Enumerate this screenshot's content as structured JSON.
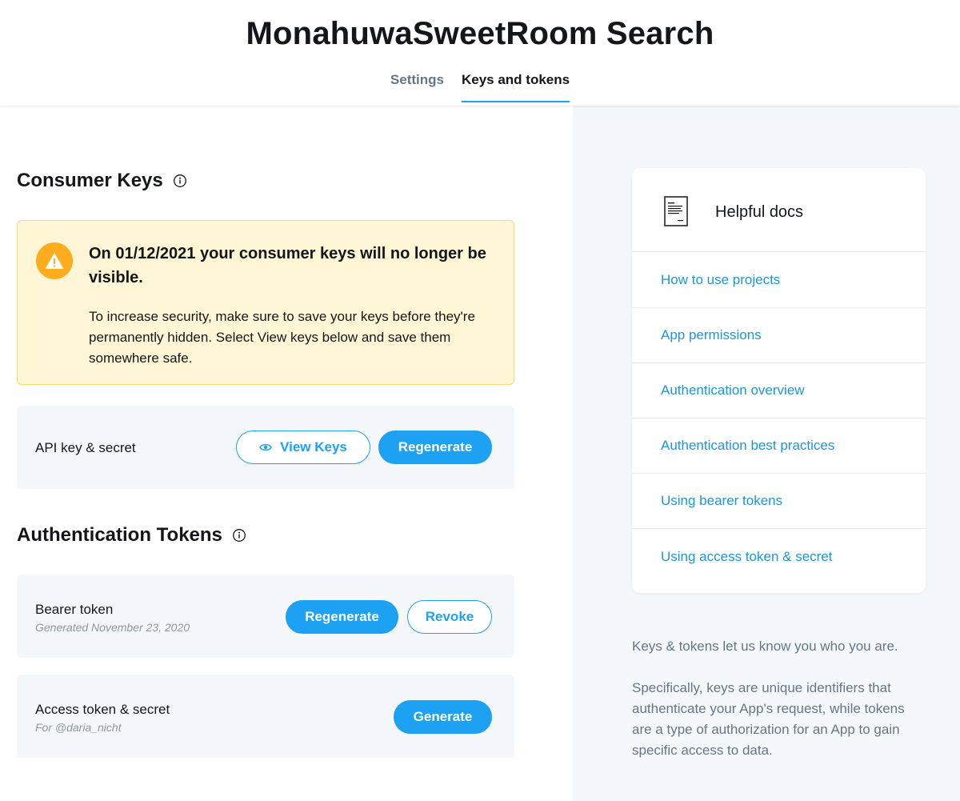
{
  "app": {
    "title": "MonahuwaSweetRoom Search"
  },
  "tabs": [
    {
      "label": "Settings",
      "active": false
    },
    {
      "label": "Keys and tokens",
      "active": true
    }
  ],
  "consumer_keys": {
    "title": "Consumer Keys",
    "warning": {
      "title": "On 01/12/2021 your consumer keys will no longer be visible.",
      "body": "To increase security, make sure to save your keys before they're permanently hidden. Select View keys below and save them somewhere safe."
    },
    "api_card": {
      "label": "API key & secret",
      "view_button": "View Keys",
      "regenerate_button": "Regenerate"
    }
  },
  "auth_tokens": {
    "title": "Authentication Tokens",
    "bearer": {
      "label": "Bearer token",
      "sub": "Generated November 23, 2020",
      "regenerate_button": "Regenerate",
      "revoke_button": "Revoke"
    },
    "access": {
      "label": "Access token & secret",
      "sub": "For @daria_nicht",
      "generate_button": "Generate"
    }
  },
  "helpful_docs": {
    "title": "Helpful docs",
    "links": [
      "How to use projects",
      "App permissions",
      "Authentication overview",
      "Authentication best practices",
      "Using bearer tokens",
      "Using access token & secret"
    ]
  },
  "side_text": {
    "p1": "Keys & tokens let us know you who you are.",
    "p2": "Specifically, keys are unique identifiers that authenticate your App's request, while tokens are a type of authorization for an App to gain specific access to data."
  },
  "colors": {
    "accent": "#1da1f2",
    "link": "#1b95e0",
    "warning_bg": "#fef6d4",
    "warning_icon": "#ffad1f",
    "panel_bg": "#f5f8fa"
  }
}
